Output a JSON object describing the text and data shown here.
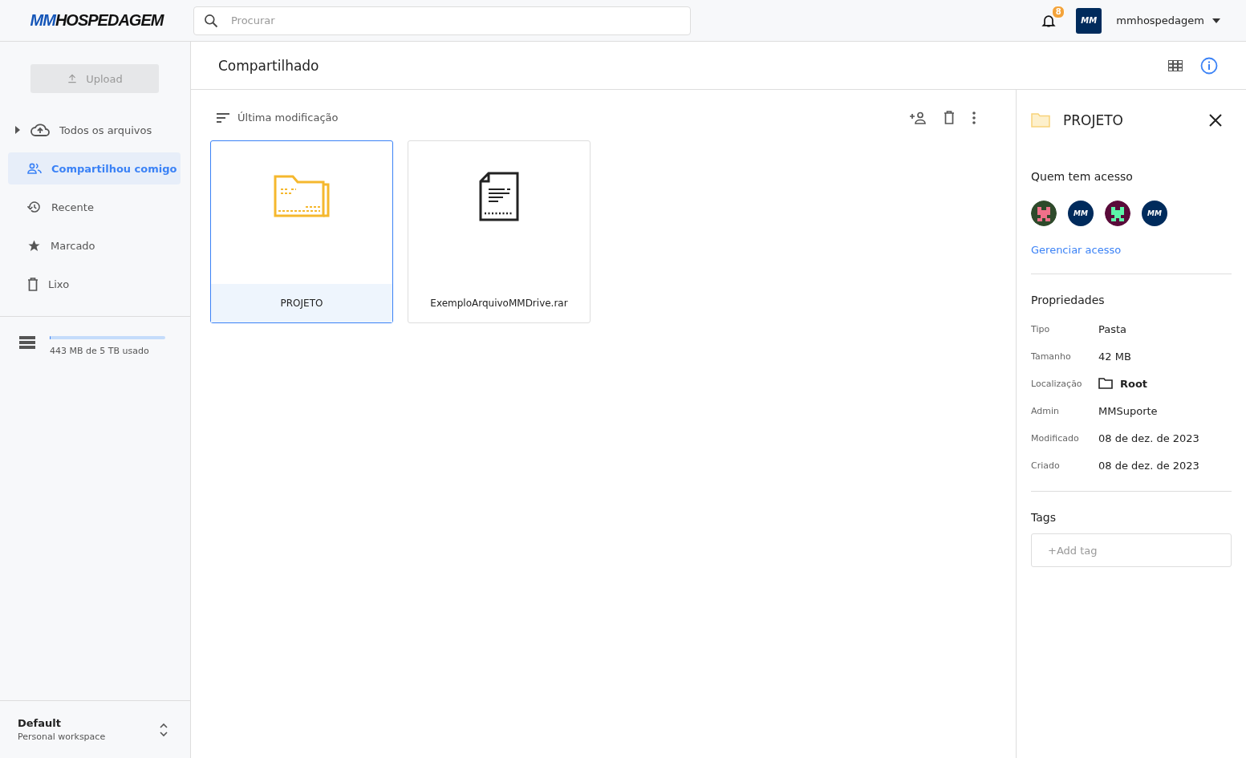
{
  "logo": {
    "accent": "MM",
    "rest": "HOSPEDAGEM"
  },
  "search": {
    "placeholder": "Procurar"
  },
  "notifications": {
    "count": "8"
  },
  "user": {
    "avatar_text": "MM",
    "name": "mmhospedagem"
  },
  "upload": {
    "label": "Upload",
    "disabled": true
  },
  "sidebar": {
    "items": [
      {
        "label": "Todos os arquivos",
        "kind": "all",
        "selected": false,
        "expanded": false
      },
      {
        "label": "Compartilhou comigo",
        "kind": "shared",
        "selected": true
      },
      {
        "label": "Recente",
        "kind": "recent",
        "selected": false
      },
      {
        "label": "Marcado",
        "kind": "starred",
        "selected": false
      },
      {
        "label": "Lixo",
        "kind": "trash",
        "selected": false
      }
    ],
    "storage": {
      "level": 0.002,
      "text": "443 MB de 5 TB usado"
    },
    "workspace": {
      "name": "Default",
      "subtitle": "Personal workspace"
    }
  },
  "page": {
    "title": "Compartilhado"
  },
  "sort": {
    "label": "Última modificação"
  },
  "files": [
    {
      "name": "PROJETO",
      "kind": "folder",
      "selected": true
    },
    {
      "name": "ExemploArquivoMMDrive.rar",
      "kind": "file",
      "selected": false
    }
  ],
  "details": {
    "title": "PROJETO",
    "access_heading": "Quem tem acesso",
    "access": [
      {
        "kind": "pixel",
        "color": "#2e4a2b"
      },
      {
        "kind": "logo",
        "color": "#002b5c",
        "text": "MM"
      },
      {
        "kind": "pixel",
        "color": "#5a0b3a"
      },
      {
        "kind": "logo",
        "color": "#002b5c",
        "text": "MM"
      }
    ],
    "manage_link": "Gerenciar acesso",
    "properties_heading": "Propriedades",
    "properties": [
      {
        "label": "Tipo",
        "value": "Pasta",
        "kind": "text"
      },
      {
        "label": "Tamanho",
        "value": "42 MB",
        "kind": "text"
      },
      {
        "label": "Localização",
        "value": "Root",
        "kind": "location"
      },
      {
        "label": "Admin",
        "value": "MMSuporte",
        "kind": "text"
      },
      {
        "label": "Modificado",
        "value": "08 de dez. de 2023",
        "kind": "text"
      },
      {
        "label": "Criado",
        "value": "08 de dez. de 2023",
        "kind": "text"
      }
    ],
    "tags_heading": "Tags",
    "tag_placeholder": "+Add tag"
  }
}
